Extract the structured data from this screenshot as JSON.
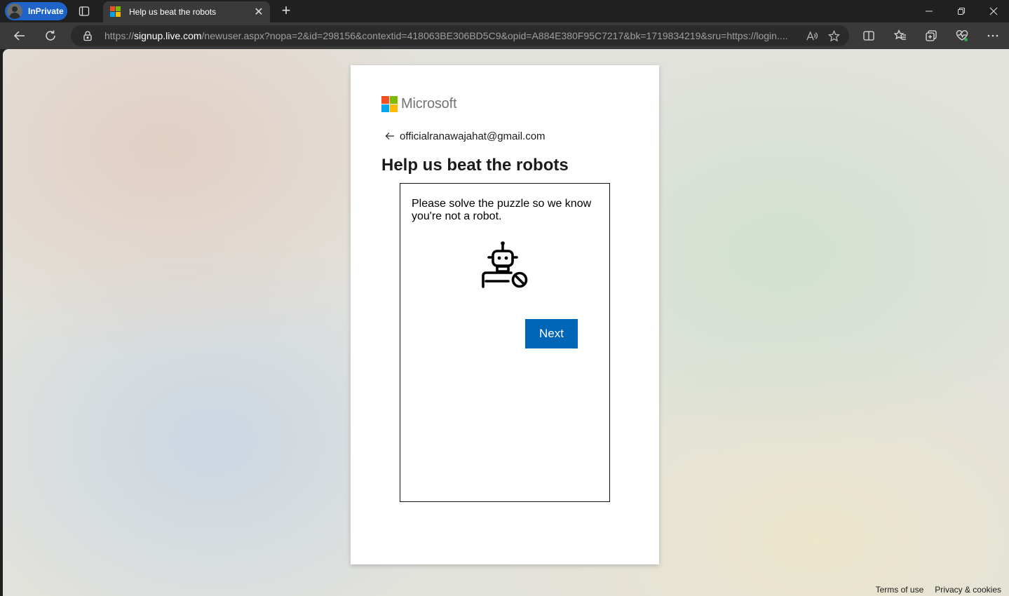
{
  "browser": {
    "inprivate_label": "InPrivate",
    "tab": {
      "title": "Help us beat the robots"
    },
    "url": {
      "scheme": "https://",
      "host": "signup.live.com",
      "rest": "/newuser.aspx?nopa=2&id=298156&contextid=418063BE306BD5C9&opid=A884E380F95C7217&bk=1719834219&sru=https://login...."
    }
  },
  "card": {
    "brand": "Microsoft",
    "email": "officialranawajahat@gmail.com",
    "title": "Help us beat the robots",
    "puzzle": {
      "prompt": "Please solve the puzzle so we know you're not a robot.",
      "next_label": "Next"
    }
  },
  "footer": {
    "terms": "Terms of use",
    "privacy": "Privacy & cookies"
  },
  "colors": {
    "accent": "#0067b8",
    "inprivate": "#1e64c8"
  }
}
